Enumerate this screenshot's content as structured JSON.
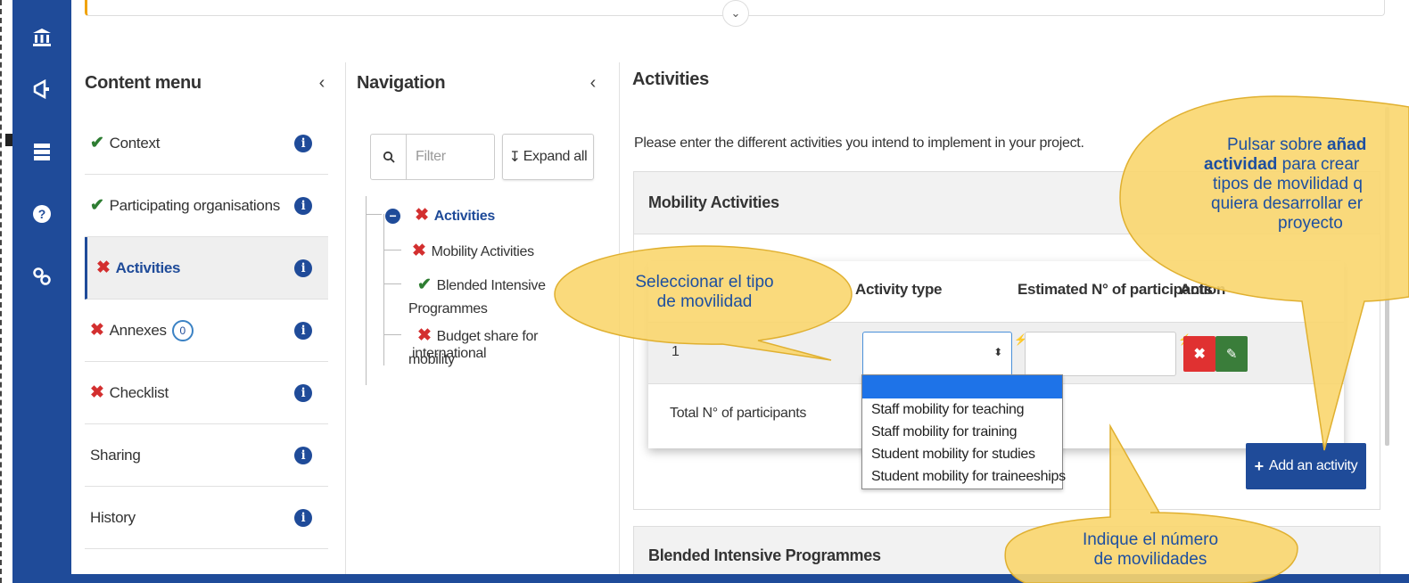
{
  "rail_icons": [
    "institution-icon",
    "megaphone-icon",
    "list-icon",
    "help-icon",
    "link-icon"
  ],
  "content_menu": {
    "title": "Content menu",
    "collapse": "‹",
    "items": [
      {
        "label": "Context",
        "status": "done"
      },
      {
        "label": "Participating organisations",
        "status": "done"
      },
      {
        "label": "Activities",
        "status": "error",
        "active": true
      },
      {
        "label": "Annexes",
        "status": "error",
        "badge": "0"
      },
      {
        "label": "Checklist",
        "status": "error"
      },
      {
        "label": "Sharing",
        "status": "none"
      },
      {
        "label": "History",
        "status": "none"
      }
    ]
  },
  "navigation": {
    "title": "Navigation",
    "collapse": "‹",
    "filter_placeholder": "Filter",
    "expand_label": "Expand all",
    "tree": {
      "root": "Activities",
      "children": [
        "Mobility Activities",
        "Blended Intensive",
        "Programmes",
        "Budget share for international",
        "mobility"
      ]
    }
  },
  "activities": {
    "title": "Activities",
    "intro": "Please enter the different activities you intend to implement in your project.",
    "mobility_section": "Mobility Activities",
    "columns": {
      "type": "Activity type",
      "participants": "Estimated N° of participants",
      "action": "Action"
    },
    "row_number": "1",
    "total_label": "Total N° of participants",
    "dropdown_options": [
      "",
      "Staff mobility for teaching",
      "Staff mobility for training",
      "Student mobility for studies",
      "Student mobility for traineeships"
    ],
    "add_button": "Add an activity",
    "bip_section": "Blended Intensive Programmes"
  },
  "callouts": {
    "select_type": [
      "Seleccionar el tipo",
      "de movilidad"
    ],
    "add_activity": {
      "line1_a": "Pulsar sobre ",
      "line1_b": "añad",
      "line2_b": "actividad",
      "line2_a": " para crear",
      "line3": "tipos de movilidad q",
      "line4": "quiera desarrollar er",
      "line5": "proyecto"
    },
    "number": [
      "Indique el número",
      "de movilidades"
    ]
  },
  "colors": {
    "brand": "#1f4b99",
    "callout": "#f9d66e",
    "callout_text": "#1d4fa0",
    "error": "#d32f2f",
    "ok": "#2e7d32"
  }
}
